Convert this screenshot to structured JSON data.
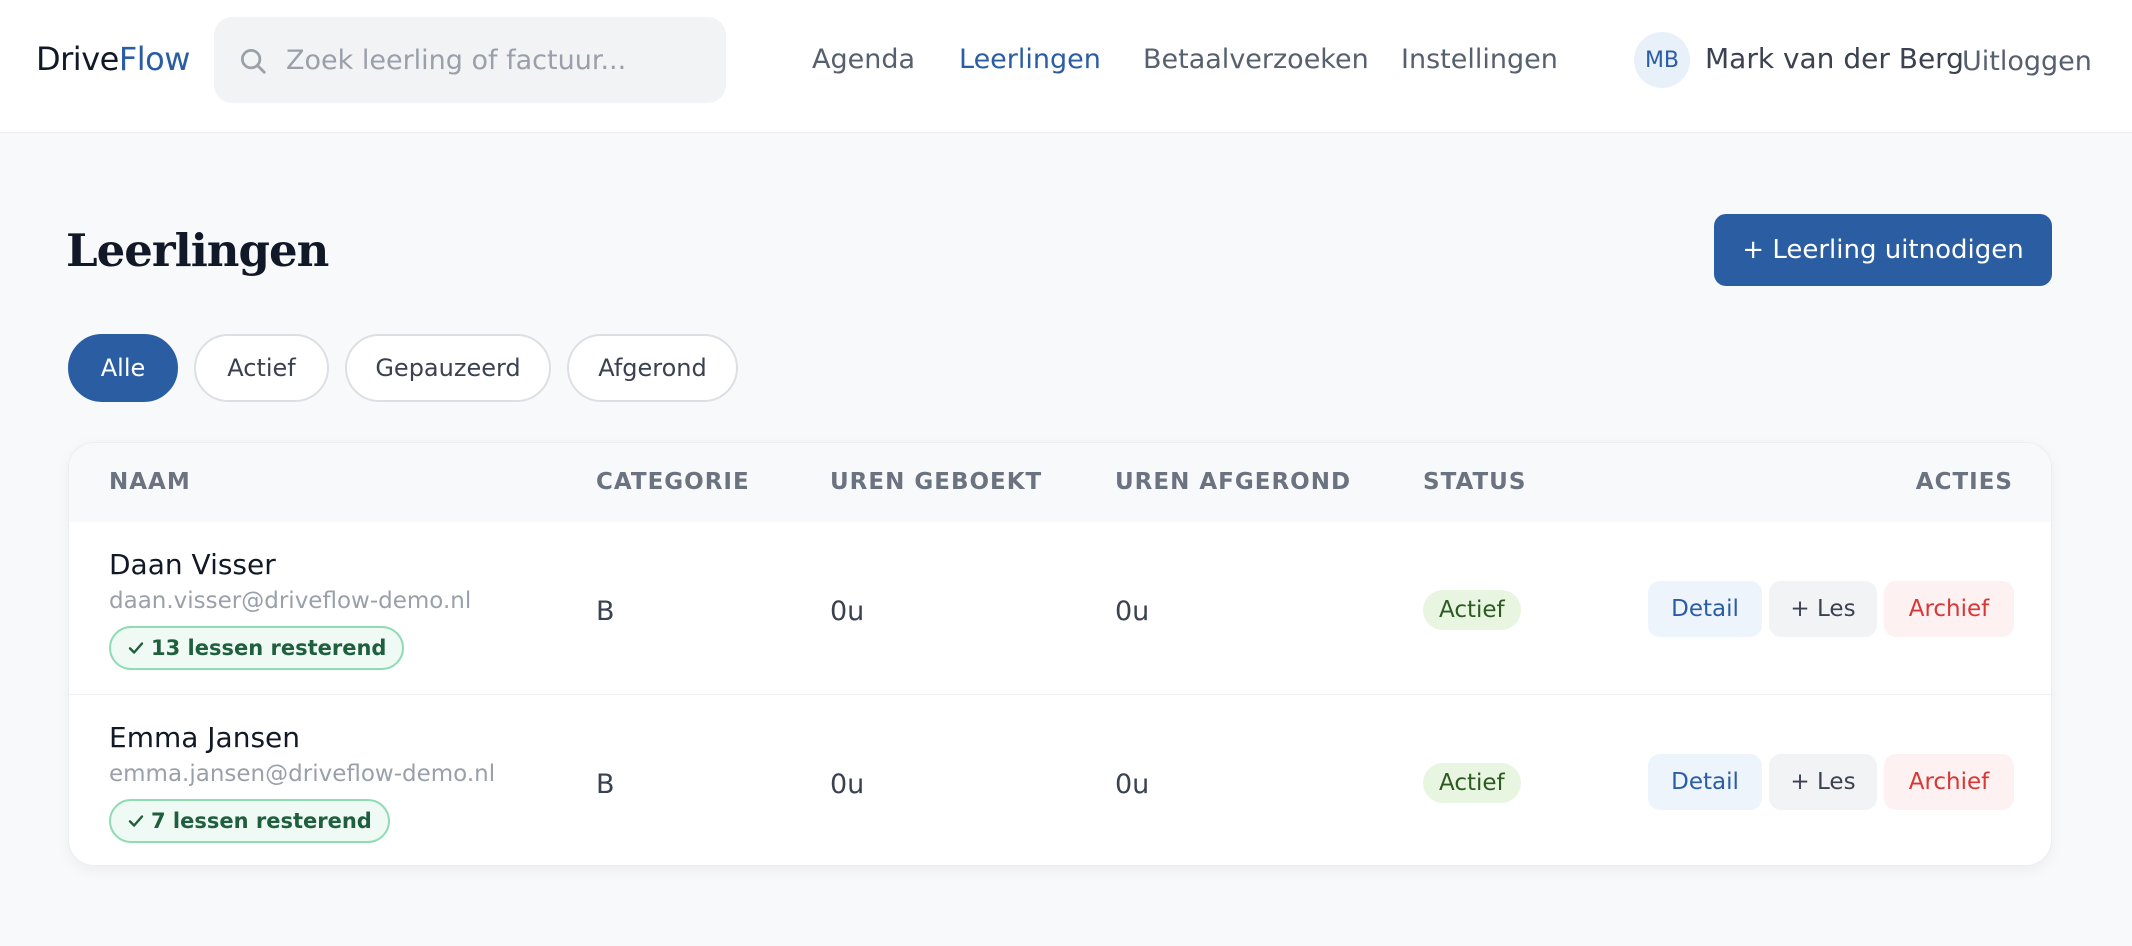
{
  "header": {
    "logo_part1": "Drive",
    "logo_part2": "Flow",
    "search_placeholder": "Zoek leerling of factuur...",
    "nav": [
      {
        "label": "Agenda"
      },
      {
        "label": "Leerlingen"
      },
      {
        "label": "Betaalverzoeken"
      },
      {
        "label": "Instellingen"
      }
    ],
    "active_nav": "Leerlingen",
    "user_initials": "MB",
    "user_name": "Mark van der Berg",
    "logout_label": "Uitloggen"
  },
  "page": {
    "title": "Leerlingen",
    "invite_label": "+ Leerling uitnodigen"
  },
  "filters": [
    {
      "label": "Alle"
    },
    {
      "label": "Actief"
    },
    {
      "label": "Gepauzeerd"
    },
    {
      "label": "Afgerond"
    }
  ],
  "active_filter": "Alle",
  "table": {
    "headers": {
      "naam": "NAAM",
      "categorie": "CATEGORIE",
      "uren_geboekt": "UREN GEBOEKT",
      "uren_afgerond": "UREN AFGEROND",
      "status": "STATUS",
      "acties": "ACTIES"
    },
    "rows": [
      {
        "name": "Daan Visser",
        "email": "daan.visser@driveflow-demo.nl",
        "remaining": "13 lessen resterend",
        "categorie": "B",
        "uren_geboekt": "0u",
        "uren_afgerond": "0u",
        "status": "Actief"
      },
      {
        "name": "Emma Jansen",
        "email": "emma.jansen@driveflow-demo.nl",
        "remaining": "7 lessen resterend",
        "categorie": "B",
        "uren_geboekt": "0u",
        "uren_afgerond": "0u",
        "status": "Actief"
      }
    ],
    "actions": {
      "detail": "Detail",
      "les": "+ Les",
      "archief": "Archief"
    }
  },
  "colors": {
    "accent": "#2b5da3",
    "danger": "#d93636",
    "success_badge_bg": "#e8f5e1"
  },
  "icons": {
    "search": "search-icon",
    "check": "check-icon"
  }
}
